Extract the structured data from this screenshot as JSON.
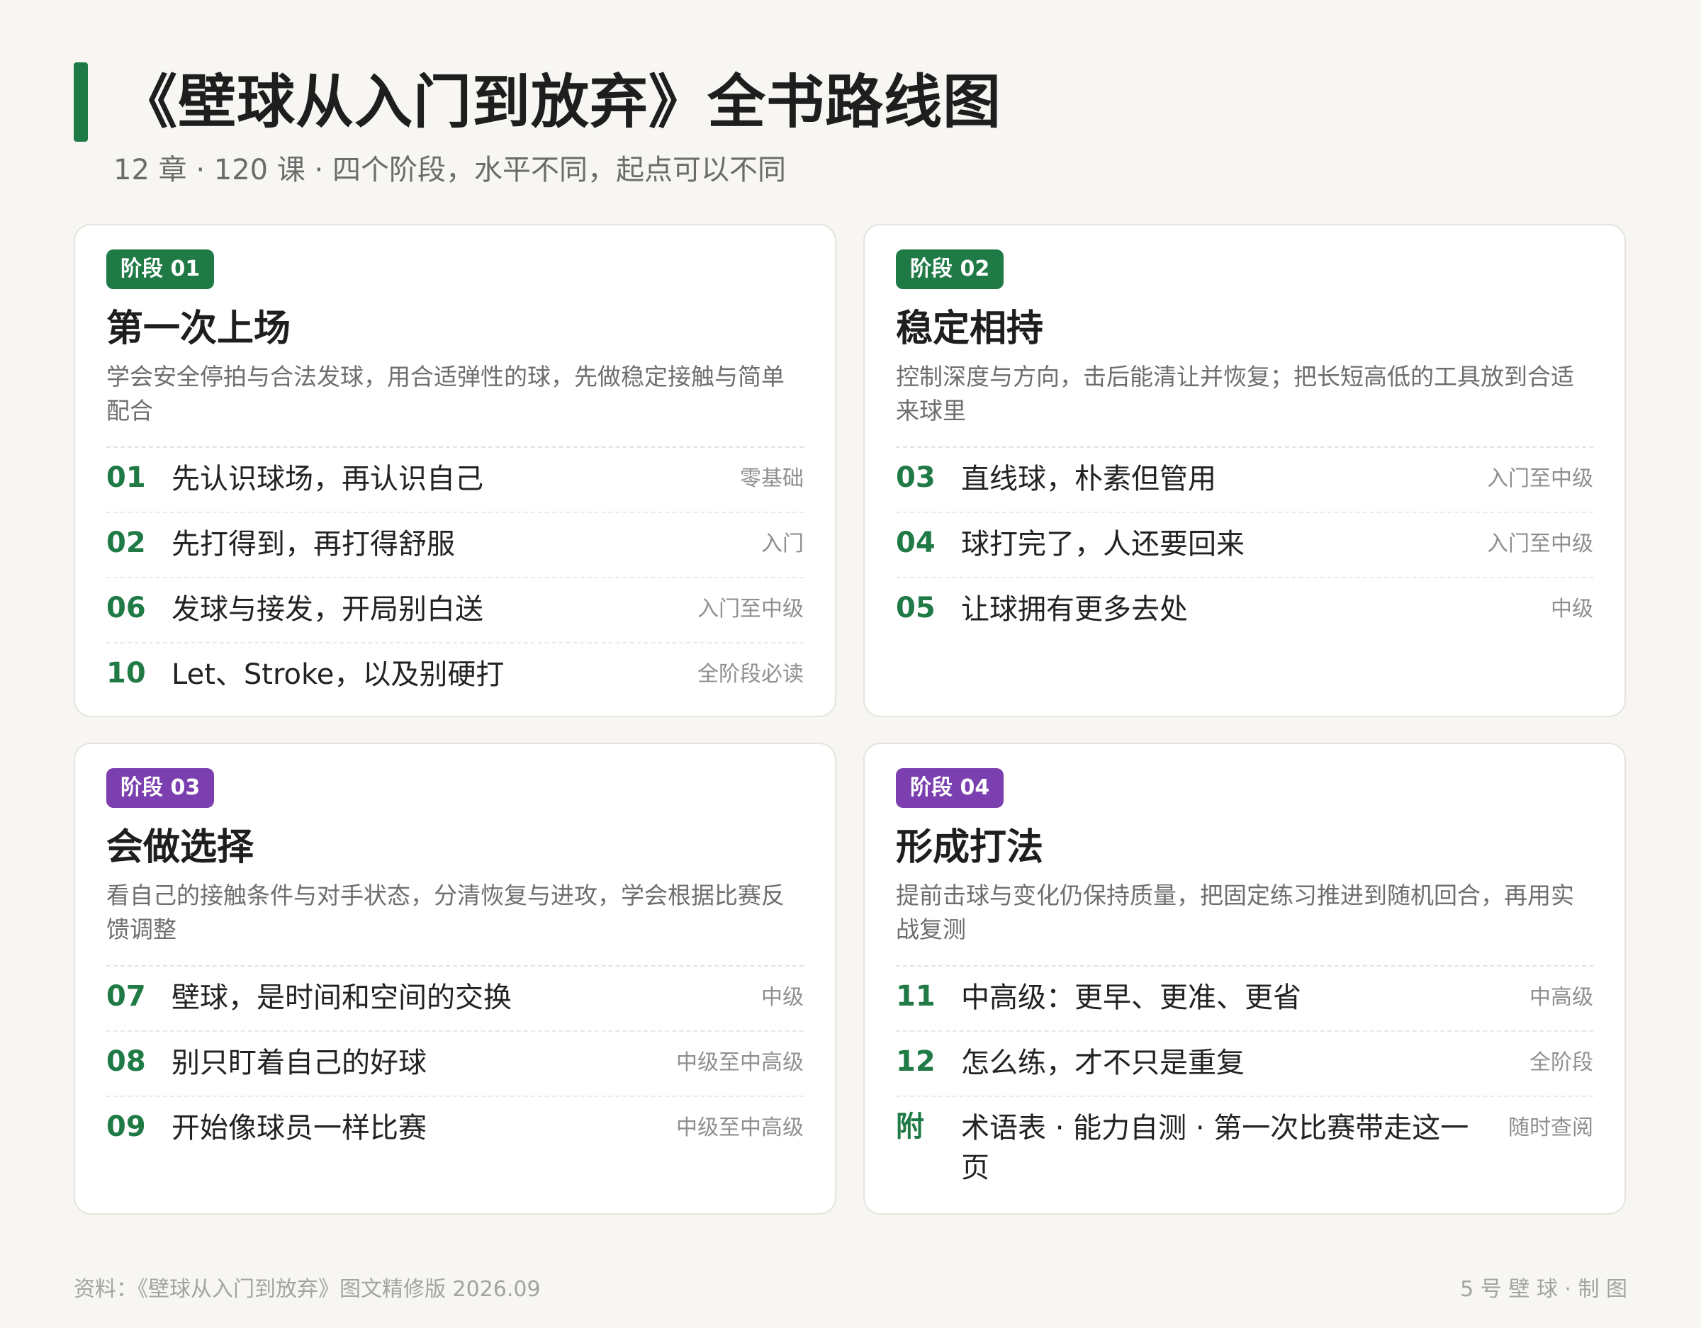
{
  "header": {
    "title": "《壁球从入门到放弃》全书路线图",
    "subtitle": "12 章 · 120 课 · 四个阶段，水平不同，起点可以不同"
  },
  "colors": {
    "accent_green": "#1f7a45",
    "accent_purple": "#7b3fb0"
  },
  "stages": [
    {
      "badge": "阶段 01",
      "badge_color": "#1f7a45",
      "title": "第一次上场",
      "description": "学会安全停拍与合法发球，用合适弹性的球，先做稳定接触与简单配合",
      "chapters": [
        {
          "num": "01",
          "title": "先认识球场，再认识自己",
          "level": "零基础"
        },
        {
          "num": "02",
          "title": "先打得到，再打得舒服",
          "level": "入门"
        },
        {
          "num": "06",
          "title": "发球与接发，开局别白送",
          "level": "入门至中级"
        },
        {
          "num": "10",
          "title": "Let、Stroke，以及别硬打",
          "level": "全阶段必读"
        }
      ]
    },
    {
      "badge": "阶段 02",
      "badge_color": "#1f7a45",
      "title": "稳定相持",
      "description": "控制深度与方向，击后能清让并恢复；把长短高低的工具放到合适来球里",
      "chapters": [
        {
          "num": "03",
          "title": "直线球，朴素但管用",
          "level": "入门至中级"
        },
        {
          "num": "04",
          "title": "球打完了，人还要回来",
          "level": "入门至中级"
        },
        {
          "num": "05",
          "title": "让球拥有更多去处",
          "level": "中级"
        }
      ]
    },
    {
      "badge": "阶段 03",
      "badge_color": "#7b3fb0",
      "title": "会做选择",
      "description": "看自己的接触条件与对手状态，分清恢复与进攻，学会根据比赛反馈调整",
      "chapters": [
        {
          "num": "07",
          "title": "壁球，是时间和空间的交换",
          "level": "中级"
        },
        {
          "num": "08",
          "title": "别只盯着自己的好球",
          "level": "中级至中高级"
        },
        {
          "num": "09",
          "title": "开始像球员一样比赛",
          "level": "中级至中高级"
        }
      ]
    },
    {
      "badge": "阶段 04",
      "badge_color": "#7b3fb0",
      "title": "形成打法",
      "description": "提前击球与变化仍保持质量，把固定练习推进到随机回合，再用实战复测",
      "chapters": [
        {
          "num": "11",
          "title": "中高级：更早、更准、更省",
          "level": "中高级"
        },
        {
          "num": "12",
          "title": "怎么练，才不只是重复",
          "level": "全阶段"
        },
        {
          "num": "附",
          "title": "术语表 · 能力自测 · 第一次比赛带走这一页",
          "level": "随时查阅"
        }
      ]
    }
  ],
  "footer": {
    "source": "资料：《壁球从入门到放弃》图文精修版 2026.09",
    "credit": "5 号 壁 球 · 制 图"
  }
}
